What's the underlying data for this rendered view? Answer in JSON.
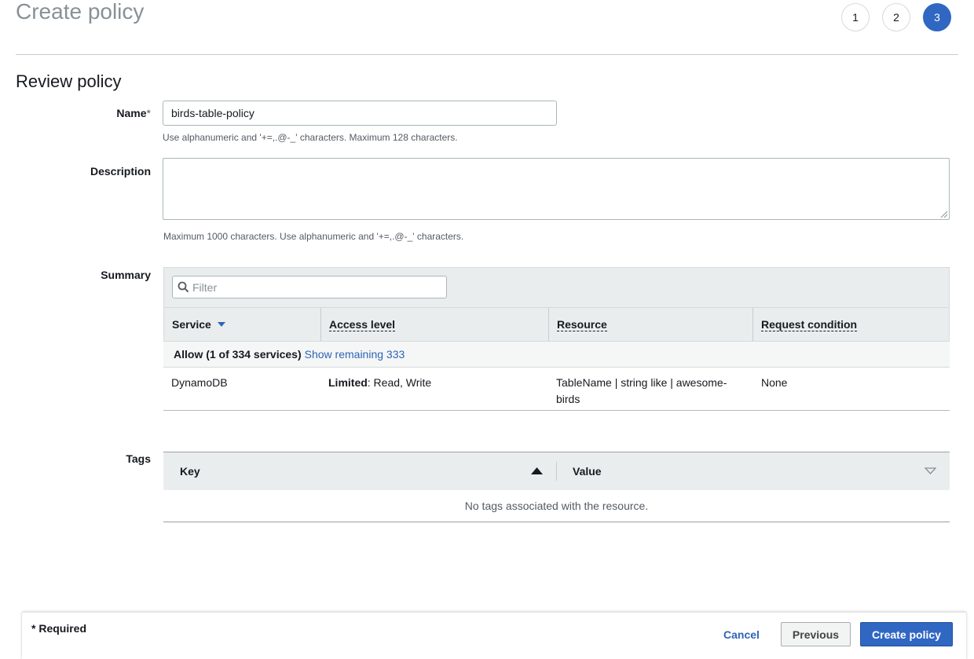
{
  "header": {
    "title": "Create policy",
    "steps": [
      "1",
      "2",
      "3"
    ],
    "active_step": "3"
  },
  "review": {
    "section_title": "Review policy",
    "name_label": "Name",
    "required_marker": "*",
    "name_value": "birds-table-policy",
    "name_hint": "Use alphanumeric and '+=,.@-_' characters. Maximum 128 characters.",
    "description_label": "Description",
    "description_value": "",
    "description_hint": "Maximum 1000 characters. Use alphanumeric and '+=,.@-_' characters."
  },
  "summary": {
    "label": "Summary",
    "filter_placeholder": "Filter",
    "columns": [
      "Service",
      "Access level",
      "Resource",
      "Request condition"
    ],
    "allow_text": "Allow (1 of 334 services)",
    "show_remaining": "Show remaining 333",
    "rows": [
      {
        "service": "DynamoDB",
        "access_level_bold": "Limited",
        "access_level_rest": ": Read, Write",
        "resource_line1": "TableName | string like | awesome-",
        "resource_line2": "birds",
        "request_condition": "None"
      }
    ]
  },
  "tags": {
    "label": "Tags",
    "columns": [
      "Key",
      "Value"
    ],
    "empty_text": "No tags associated with the resource."
  },
  "footer": {
    "required_note": "* Required",
    "cancel_label": "Cancel",
    "previous_label": "Previous",
    "create_label": "Create policy"
  },
  "colors": {
    "primary": "#3067c3",
    "link": "#2e64b7",
    "header_bg": "#eaeded"
  },
  "icons": [
    "search-icon",
    "caret-down-icon",
    "sort-ascending-icon",
    "sort-descending-icon",
    "resize-grip-icon"
  ]
}
